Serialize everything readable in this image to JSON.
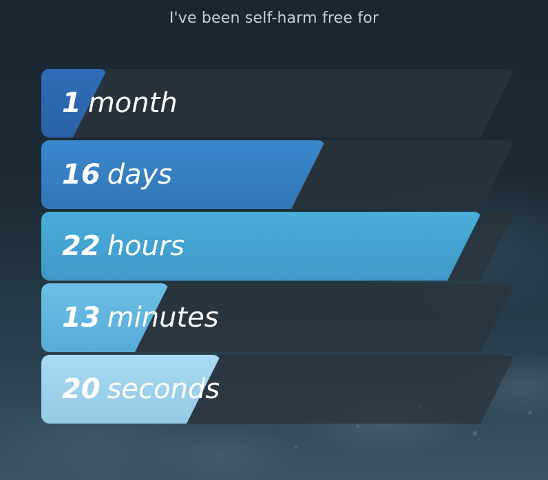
{
  "header": {
    "text": "I've been self-harm free for"
  },
  "counters": [
    {
      "value": "1",
      "unit": "month",
      "fill_fraction": 0.14
    },
    {
      "value": "16",
      "unit": "days",
      "fill_fraction": 0.6
    },
    {
      "value": "22",
      "unit": "hours",
      "fill_fraction": 0.93
    },
    {
      "value": "13",
      "unit": "minutes",
      "fill_fraction": 0.27
    },
    {
      "value": "20",
      "unit": "seconds",
      "fill_fraction": 0.38
    }
  ],
  "colors": {
    "track": "#2a343c",
    "month_fill": "#2f6db6",
    "days_fill": "#3a88cc",
    "hours_fill": "#4aaedb",
    "minutes_fill": "#6cc0e6",
    "seconds_fill": "#a8daf3"
  }
}
